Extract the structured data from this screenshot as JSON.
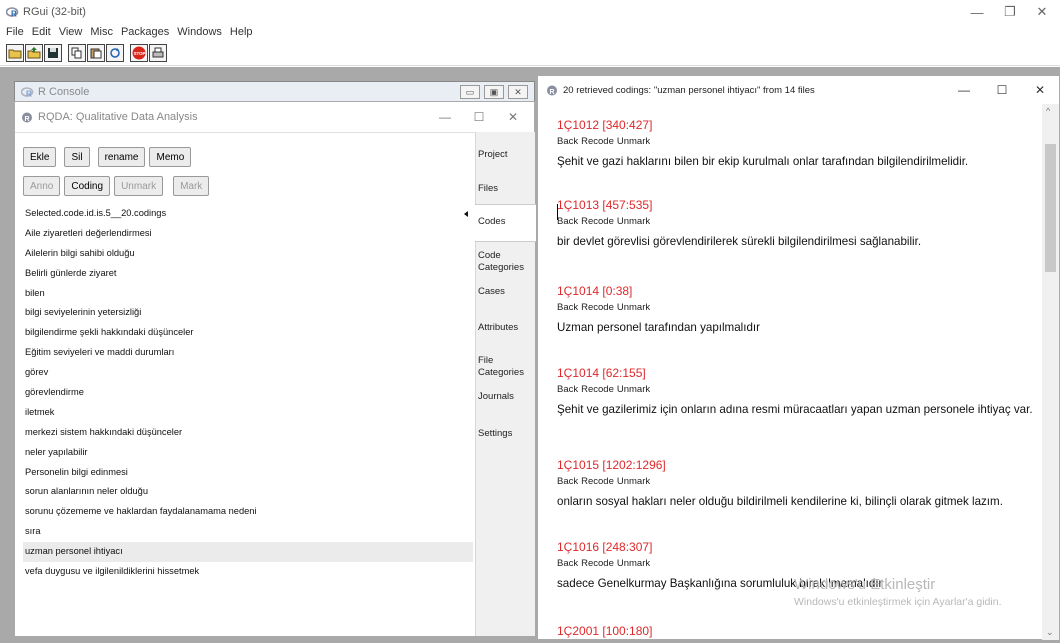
{
  "app": {
    "title": "RGui (32-bit)",
    "menu": [
      "File",
      "Edit",
      "View",
      "Misc",
      "Packages",
      "Windows",
      "Help"
    ],
    "toolbar_icons": [
      "open-script-icon",
      "load-workspace-icon",
      "save-icon",
      "copy-icon",
      "paste-icon",
      "refresh-icon",
      "stop-icon",
      "print-icon"
    ],
    "stop_label": "STOP"
  },
  "console": {
    "title": "R Console"
  },
  "rqda": {
    "title": "RQDA: Qualitative Data Analysis",
    "buttons_row1": [
      "Ekle",
      "Sil",
      "rename",
      "Memo"
    ],
    "buttons_row2": [
      "Anno",
      "Coding",
      "Unmark",
      "Mark"
    ],
    "codes": [
      "Selected.code.id.is.5__20.codings",
      "Aile ziyaretleri değerlendirmesi",
      "Ailelerin bilgi sahibi olduğu",
      "Belirli günlerde ziyaret",
      "bilen",
      "bilgi seviyelerinin yetersizliği",
      "bilgilendirme şekli hakkındaki düşünceler",
      "Eğitim seviyeleri ve maddi durumları",
      "görev",
      "görevlendirme",
      "iletmek",
      "merkezi sistem hakkındaki düşünceler",
      "neler yapılabilir",
      "Personelin bilgi edinmesi",
      "sorun alanlarının neler olduğu",
      "sorunu çözememe ve haklardan faydalanamama nedeni",
      "sıra",
      "uzman personel ihtiyacı",
      "vefa duygusu ve ilgilenildiklerini hissetmek"
    ],
    "tabs": [
      "Project",
      "Files",
      "Codes",
      "Code Categories",
      "Cases",
      "Attributes",
      "File Categories",
      "Journals",
      "Settings"
    ]
  },
  "retrieved": {
    "title": "20 retrieved codings: \"uzman personel ihtiyacı\" from 14 files",
    "actions": [
      "Back",
      "Recode",
      "Unmark"
    ],
    "codings": [
      {
        "id": "1Ç1012 [340:427]",
        "text": "Şehit ve gazi haklarını bilen bir ekip kurulmalı onlar tarafından bilgilendirilmelidir."
      },
      {
        "id": "1Ç1013 [457:535]",
        "text": "bir devlet görevlisi görevlendirilerek sürekli bilgilendirilmesi sağlanabilir."
      },
      {
        "id": "1Ç1014 [0:38]",
        "text": "Uzman personel tarafından yapılmalıdır"
      },
      {
        "id": "1Ç1014 [62:155]",
        "text": "Şehit ve gazilerimiz için onların adına resmi müracaatları yapan uzman personele ihtiyaç var."
      },
      {
        "id": "1Ç1015 [1202:1296]",
        "text": "onların sosyal hakları neler olduğu bildirilmeli kendilerine ki, bilinçli olarak gitmek lazım."
      },
      {
        "id": "1Ç1016 [248:307]",
        "text": "sadece Genelkurmay Başkanlığına sorumluluk bırakılmamalıdır"
      },
      {
        "id": "1Ç2001 [100:180]",
        "text": ""
      }
    ]
  },
  "watermark": {
    "line1": "Windows'u Etkinleştir",
    "line2": "Windows'u etkinleştirmek için Ayarlar'a gidin."
  }
}
